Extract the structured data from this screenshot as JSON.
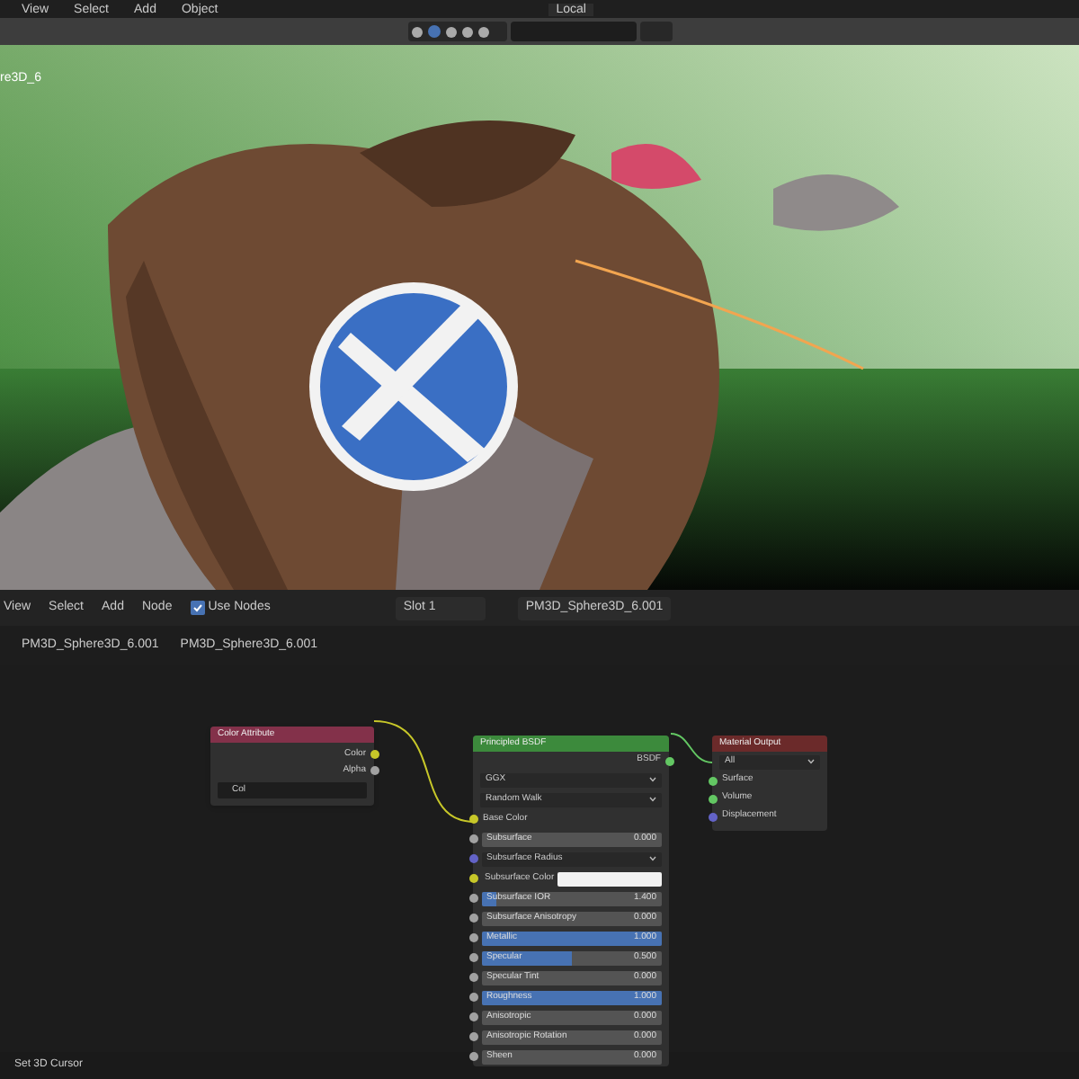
{
  "top_menu": [
    "View",
    "Select",
    "Add",
    "Object"
  ],
  "transform_orientation": "Local",
  "viewport": {
    "object_label": "re3D_6"
  },
  "node_header": {
    "menu": [
      "View",
      "Select",
      "Add",
      "Node"
    ],
    "use_nodes": {
      "label": "Use Nodes",
      "checked": true
    },
    "slot": "Slot 1",
    "material": "PM3D_Sphere3D_6.001"
  },
  "breadcrumbs": [
    "PM3D_Sphere3D_6.001",
    "PM3D_Sphere3D_6.001"
  ],
  "nodes": {
    "color_attribute": {
      "title": "Color Attribute",
      "outputs": [
        {
          "label": "Color",
          "color": "#c7c729"
        },
        {
          "label": "Alpha",
          "color": "#a1a1a1"
        }
      ],
      "layer": "Col"
    },
    "principled": {
      "title": "Principled BSDF",
      "output": "BSDF",
      "dropdowns": [
        "GGX",
        "Random Walk"
      ],
      "rows": [
        {
          "kind": "socket",
          "label": "Base Color",
          "color": "#c7c729"
        },
        {
          "kind": "slider",
          "label": "Subsurface",
          "value": "0.000",
          "level": 0,
          "color": "#a1a1a1"
        },
        {
          "kind": "dropdown",
          "label": "Subsurface Radius",
          "color": "#6363c7"
        },
        {
          "kind": "color",
          "label": "Subsurface Color",
          "color": "#c7c729"
        },
        {
          "kind": "slider",
          "label": "Subsurface IOR",
          "value": "1.400",
          "level": 0.08,
          "color": "#a1a1a1"
        },
        {
          "kind": "slider",
          "label": "Subsurface Anisotropy",
          "value": "0.000",
          "level": 0,
          "color": "#a1a1a1"
        },
        {
          "kind": "slider",
          "label": "Metallic",
          "value": "1.000",
          "level": 1,
          "color": "#a1a1a1"
        },
        {
          "kind": "slider",
          "label": "Specular",
          "value": "0.500",
          "level": 0.5,
          "color": "#a1a1a1"
        },
        {
          "kind": "slider",
          "label": "Specular Tint",
          "value": "0.000",
          "level": 0,
          "color": "#a1a1a1"
        },
        {
          "kind": "slider",
          "label": "Roughness",
          "value": "1.000",
          "level": 1,
          "color": "#a1a1a1"
        },
        {
          "kind": "slider",
          "label": "Anisotropic",
          "value": "0.000",
          "level": 0,
          "color": "#a1a1a1"
        },
        {
          "kind": "slider",
          "label": "Anisotropic Rotation",
          "value": "0.000",
          "level": 0,
          "color": "#a1a1a1"
        },
        {
          "kind": "slider",
          "label": "Sheen",
          "value": "0.000",
          "level": 0,
          "color": "#a1a1a1"
        }
      ]
    },
    "material_output": {
      "title": "Material Output",
      "target": "All",
      "inputs": [
        {
          "label": "Surface",
          "color": "#63c763"
        },
        {
          "label": "Volume",
          "color": "#63c763"
        },
        {
          "label": "Displacement",
          "color": "#6363c7"
        }
      ]
    }
  },
  "status_bar": {
    "hint": "Set 3D Cursor"
  }
}
